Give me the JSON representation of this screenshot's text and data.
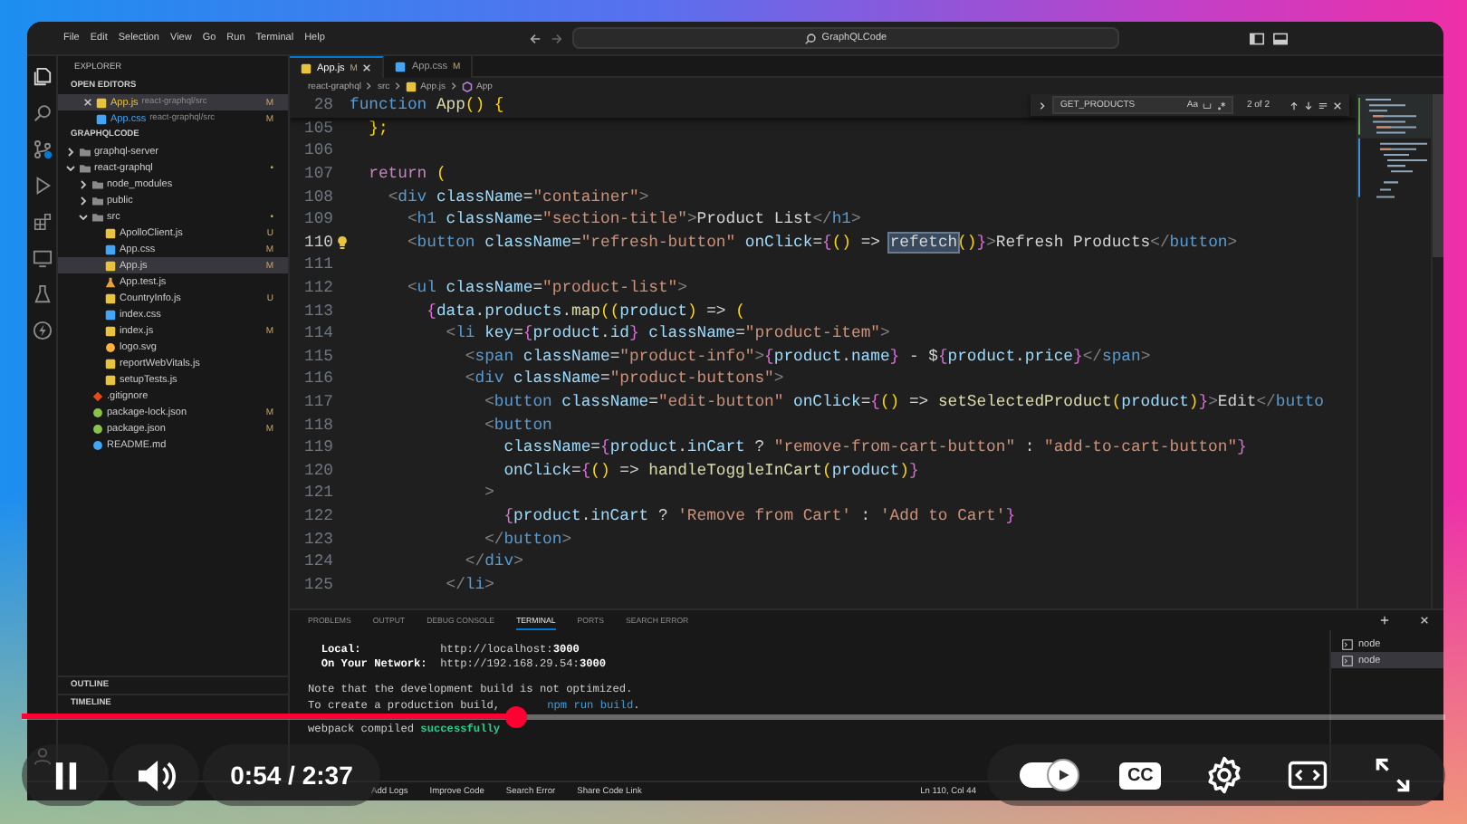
{
  "title_bar": {
    "menu": [
      "File",
      "Edit",
      "Selection",
      "View",
      "Go",
      "Run",
      "Terminal",
      "Help"
    ],
    "command_center": "GraphQLCode"
  },
  "sidebar": {
    "title": "EXPLORER",
    "open_editors": {
      "title": "OPEN EDITORS",
      "items": [
        {
          "kind": "js",
          "label": "App.js",
          "path": "react-graphql/src",
          "badge": "M",
          "selected": true
        },
        {
          "kind": "css",
          "label": "App.css",
          "path": "react-graphql/src",
          "badge": "M",
          "selected": false
        }
      ]
    },
    "workspace": {
      "title": "GRAPHQLCODE",
      "tree": [
        {
          "kind": "folder",
          "label": "graphql-server",
          "expanded": false,
          "selected": false
        },
        {
          "kind": "folder",
          "label": "react-graphql",
          "badge": "•",
          "expanded": true,
          "selected": false,
          "children": [
            {
              "kind": "folder",
              "label": "node_modules",
              "expanded": false,
              "selected": false
            },
            {
              "kind": "folder",
              "label": "public",
              "expanded": false,
              "selected": false
            },
            {
              "kind": "folder",
              "label": "src",
              "badge": "•",
              "expanded": true,
              "selected": false,
              "children": [
                {
                  "kind": "js",
                  "label": "ApolloClient.js",
                  "badge": "U",
                  "selected": false
                },
                {
                  "kind": "css",
                  "label": "App.css",
                  "badge": "M",
                  "selected": false
                },
                {
                  "kind": "js",
                  "label": "App.js",
                  "badge": "M",
                  "selected": true
                },
                {
                  "kind": "test",
                  "label": "App.test.js",
                  "selected": false
                },
                {
                  "kind": "js",
                  "label": "CountryInfo.js",
                  "badge": "U",
                  "selected": false
                },
                {
                  "kind": "css",
                  "label": "index.css",
                  "selected": false
                },
                {
                  "kind": "js",
                  "label": "index.js",
                  "badge": "M",
                  "selected": false
                },
                {
                  "kind": "svg",
                  "label": "logo.svg",
                  "selected": false
                },
                {
                  "kind": "js",
                  "label": "reportWebVitals.js",
                  "selected": false
                },
                {
                  "kind": "js",
                  "label": "setupTests.js",
                  "selected": false
                }
              ]
            },
            {
              "kind": "git",
              "label": ".gitignore",
              "selected": false
            },
            {
              "kind": "json",
              "label": "package-lock.json",
              "badge": "M",
              "selected": false
            },
            {
              "kind": "json",
              "label": "package.json",
              "badge": "M",
              "selected": false
            },
            {
              "kind": "md",
              "label": "README.md",
              "selected": false
            }
          ]
        }
      ]
    },
    "outline": "OUTLINE",
    "timeline": "TIMELINE"
  },
  "editor": {
    "tabs": [
      {
        "kind": "js",
        "label": "App.js",
        "badge": "M",
        "selected": true
      },
      {
        "kind": "css",
        "label": "App.css",
        "badge": "M",
        "selected": false
      }
    ],
    "breadcrumb": [
      {
        "kind": "folder",
        "label": "react-graphql"
      },
      {
        "kind": "folder",
        "label": "src"
      },
      {
        "kind": "js",
        "label": "App.js"
      },
      {
        "kind": "symbol",
        "label": "App"
      }
    ],
    "find": {
      "value": "GET_PRODUCTS",
      "match_case": "Aa",
      "count": "2 of 2"
    },
    "sticky_line": {
      "number": "28",
      "tokens": [
        {
          "kind": "keyword",
          "text": "function "
        },
        {
          "kind": "fn",
          "text": "App"
        },
        {
          "kind": "paren",
          "text": "() {"
        }
      ]
    },
    "lines": [
      {
        "number": "105",
        "current": false,
        "tokens": [
          {
            "kind": "paren",
            "text": "  };"
          }
        ]
      },
      {
        "number": "106",
        "current": false
      },
      {
        "number": "107",
        "current": false,
        "tokens": [
          {
            "kind": "control",
            "text": "  return "
          },
          {
            "kind": "paren",
            "text": "("
          }
        ]
      },
      {
        "number": "108",
        "current": false,
        "tokens": [
          {
            "kind": "punct",
            "text": "    <"
          },
          {
            "kind": "tag",
            "text": "div"
          },
          {
            "kind": "attr",
            "text": " className"
          },
          {
            "kind": "text",
            "text": "="
          },
          {
            "kind": "str",
            "text": "\"container\""
          },
          {
            "kind": "punct",
            "text": ">"
          }
        ]
      },
      {
        "number": "109",
        "current": false,
        "tokens": [
          {
            "kind": "punct",
            "text": "      <"
          },
          {
            "kind": "tag",
            "text": "h1"
          },
          {
            "kind": "attr",
            "text": " className"
          },
          {
            "kind": "text",
            "text": "="
          },
          {
            "kind": "str",
            "text": "\"section-title\""
          },
          {
            "kind": "punct",
            "text": ">"
          },
          {
            "kind": "text",
            "text": "Product List"
          },
          {
            "kind": "punct",
            "text": "</"
          },
          {
            "kind": "tag",
            "text": "h1"
          },
          {
            "kind": "punct",
            "text": ">"
          }
        ]
      },
      {
        "number": "110",
        "current": true,
        "tokens": [
          {
            "kind": "punct",
            "text": "      <"
          },
          {
            "kind": "tag",
            "text": "button"
          },
          {
            "kind": "attr",
            "text": " className"
          },
          {
            "kind": "text",
            "text": "="
          },
          {
            "kind": "str",
            "text": "\"refresh-button\""
          },
          {
            "kind": "attr",
            "text": " onClick"
          },
          {
            "kind": "text",
            "text": "="
          },
          {
            "kind": "brace",
            "text": "{"
          },
          {
            "kind": "paren",
            "text": "()"
          },
          {
            "kind": "text",
            "text": " => "
          },
          {
            "kind": "match",
            "text": "refetch"
          },
          {
            "kind": "paren",
            "text": "()"
          },
          {
            "kind": "brace",
            "text": "}"
          },
          {
            "kind": "punct",
            "text": ">"
          },
          {
            "kind": "text",
            "text": "Refresh Products"
          },
          {
            "kind": "punct",
            "text": "</"
          },
          {
            "kind": "tag",
            "text": "button"
          },
          {
            "kind": "punct",
            "text": ">"
          }
        ]
      },
      {
        "number": "111",
        "current": false
      },
      {
        "number": "112",
        "current": false,
        "tokens": [
          {
            "kind": "punct",
            "text": "      <"
          },
          {
            "kind": "tag",
            "text": "ul"
          },
          {
            "kind": "attr",
            "text": " className"
          },
          {
            "kind": "text",
            "text": "="
          },
          {
            "kind": "str",
            "text": "\"product-list\""
          },
          {
            "kind": "punct",
            "text": ">"
          }
        ]
      },
      {
        "number": "113",
        "current": false,
        "tokens": [
          {
            "kind": "brace",
            "text": "        {"
          },
          {
            "kind": "var",
            "text": "data"
          },
          {
            "kind": "text",
            "text": "."
          },
          {
            "kind": "var",
            "text": "products"
          },
          {
            "kind": "text",
            "text": "."
          },
          {
            "kind": "fn",
            "text": "map"
          },
          {
            "kind": "paren",
            "text": "(("
          },
          {
            "kind": "var",
            "text": "product"
          },
          {
            "kind": "paren",
            "text": ")"
          },
          {
            "kind": "text",
            "text": " => "
          },
          {
            "kind": "paren",
            "text": "("
          }
        ]
      },
      {
        "number": "114",
        "current": false,
        "tokens": [
          {
            "kind": "punct",
            "text": "          <"
          },
          {
            "kind": "tag",
            "text": "li"
          },
          {
            "kind": "attr",
            "text": " key"
          },
          {
            "kind": "text",
            "text": "="
          },
          {
            "kind": "brace",
            "text": "{"
          },
          {
            "kind": "var",
            "text": "product"
          },
          {
            "kind": "text",
            "text": "."
          },
          {
            "kind": "var",
            "text": "id"
          },
          {
            "kind": "brace",
            "text": "}"
          },
          {
            "kind": "attr",
            "text": " className"
          },
          {
            "kind": "text",
            "text": "="
          },
          {
            "kind": "str",
            "text": "\"product-item\""
          },
          {
            "kind": "punct",
            "text": ">"
          }
        ]
      },
      {
        "number": "115",
        "current": false,
        "tokens": [
          {
            "kind": "punct",
            "text": "            <"
          },
          {
            "kind": "tag",
            "text": "span"
          },
          {
            "kind": "attr",
            "text": " className"
          },
          {
            "kind": "text",
            "text": "="
          },
          {
            "kind": "str",
            "text": "\"product-info\""
          },
          {
            "kind": "punct",
            "text": ">"
          },
          {
            "kind": "brace",
            "text": "{"
          },
          {
            "kind": "var",
            "text": "product"
          },
          {
            "kind": "text",
            "text": "."
          },
          {
            "kind": "var",
            "text": "name"
          },
          {
            "kind": "brace",
            "text": "}"
          },
          {
            "kind": "text",
            "text": " - $"
          },
          {
            "kind": "brace",
            "text": "{"
          },
          {
            "kind": "var",
            "text": "product"
          },
          {
            "kind": "text",
            "text": "."
          },
          {
            "kind": "var",
            "text": "price"
          },
          {
            "kind": "brace",
            "text": "}"
          },
          {
            "kind": "punct",
            "text": "</"
          },
          {
            "kind": "tag",
            "text": "span"
          },
          {
            "kind": "punct",
            "text": ">"
          }
        ]
      },
      {
        "number": "116",
        "current": false,
        "tokens": [
          {
            "kind": "punct",
            "text": "            <"
          },
          {
            "kind": "tag",
            "text": "div"
          },
          {
            "kind": "attr",
            "text": " className"
          },
          {
            "kind": "text",
            "text": "="
          },
          {
            "kind": "str",
            "text": "\"product-buttons\""
          },
          {
            "kind": "punct",
            "text": ">"
          }
        ]
      },
      {
        "number": "117",
        "current": false,
        "tokens": [
          {
            "kind": "punct",
            "text": "              <"
          },
          {
            "kind": "tag",
            "text": "button"
          },
          {
            "kind": "attr",
            "text": " className"
          },
          {
            "kind": "text",
            "text": "="
          },
          {
            "kind": "str",
            "text": "\"edit-button\""
          },
          {
            "kind": "attr",
            "text": " onClick"
          },
          {
            "kind": "text",
            "text": "="
          },
          {
            "kind": "brace",
            "text": "{"
          },
          {
            "kind": "paren",
            "text": "()"
          },
          {
            "kind": "text",
            "text": " => "
          },
          {
            "kind": "fn",
            "text": "setSelectedProduct"
          },
          {
            "kind": "paren",
            "text": "("
          },
          {
            "kind": "var",
            "text": "product"
          },
          {
            "kind": "paren",
            "text": ")"
          },
          {
            "kind": "brace",
            "text": "}"
          },
          {
            "kind": "punct",
            "text": ">"
          },
          {
            "kind": "text",
            "text": "Edit"
          },
          {
            "kind": "punct",
            "text": "</"
          },
          {
            "kind": "tag",
            "text": "butto"
          }
        ]
      },
      {
        "number": "118",
        "current": false,
        "tokens": [
          {
            "kind": "punct",
            "text": "              <"
          },
          {
            "kind": "tag",
            "text": "button"
          }
        ]
      },
      {
        "number": "119",
        "current": false,
        "tokens": [
          {
            "kind": "attr",
            "text": "                className"
          },
          {
            "kind": "text",
            "text": "="
          },
          {
            "kind": "brace",
            "text": "{"
          },
          {
            "kind": "var",
            "text": "product"
          },
          {
            "kind": "text",
            "text": "."
          },
          {
            "kind": "var",
            "text": "inCart"
          },
          {
            "kind": "text",
            "text": " ? "
          },
          {
            "kind": "str",
            "text": "\"remove-from-cart-button\""
          },
          {
            "kind": "text",
            "text": " : "
          },
          {
            "kind": "str",
            "text": "\"add-to-cart-button\""
          },
          {
            "kind": "brace",
            "text": "}"
          }
        ]
      },
      {
        "number": "120",
        "current": false,
        "tokens": [
          {
            "kind": "attr",
            "text": "                onClick"
          },
          {
            "kind": "text",
            "text": "="
          },
          {
            "kind": "brace",
            "text": "{"
          },
          {
            "kind": "paren",
            "text": "()"
          },
          {
            "kind": "text",
            "text": " => "
          },
          {
            "kind": "fn",
            "text": "handleToggleInCart"
          },
          {
            "kind": "paren",
            "text": "("
          },
          {
            "kind": "var",
            "text": "product"
          },
          {
            "kind": "paren",
            "text": ")"
          },
          {
            "kind": "brace",
            "text": "}"
          }
        ]
      },
      {
        "number": "121",
        "current": false,
        "tokens": [
          {
            "kind": "punct",
            "text": "              >"
          }
        ]
      },
      {
        "number": "122",
        "current": false,
        "tokens": [
          {
            "kind": "brace",
            "text": "                {"
          },
          {
            "kind": "var",
            "text": "product"
          },
          {
            "kind": "text",
            "text": "."
          },
          {
            "kind": "var",
            "text": "inCart"
          },
          {
            "kind": "text",
            "text": " ? "
          },
          {
            "kind": "str",
            "text": "'Remove from Cart'"
          },
          {
            "kind": "text",
            "text": " : "
          },
          {
            "kind": "str",
            "text": "'Add to Cart'"
          },
          {
            "kind": "brace",
            "text": "}"
          }
        ]
      },
      {
        "number": "123",
        "current": false,
        "tokens": [
          {
            "kind": "punct",
            "text": "              </"
          },
          {
            "kind": "tag",
            "text": "button"
          },
          {
            "kind": "punct",
            "text": ">"
          }
        ]
      },
      {
        "number": "124",
        "current": false,
        "tokens": [
          {
            "kind": "punct",
            "text": "            </"
          },
          {
            "kind": "tag",
            "text": "div"
          },
          {
            "kind": "punct",
            "text": ">"
          }
        ]
      },
      {
        "number": "125",
        "current": false,
        "tokens": [
          {
            "kind": "punct",
            "text": "          </"
          },
          {
            "kind": "tag",
            "text": "li"
          },
          {
            "kind": "punct",
            "text": ">"
          }
        ]
      }
    ]
  },
  "panel": {
    "tabs": [
      {
        "label": "PROBLEMS",
        "selected": false
      },
      {
        "label": "OUTPUT",
        "selected": false
      },
      {
        "label": "DEBUG CONSOLE",
        "selected": false
      },
      {
        "label": "TERMINAL",
        "selected": true
      },
      {
        "label": "PORTS",
        "selected": false
      },
      {
        "label": "SEARCH ERROR",
        "selected": false
      }
    ],
    "terminal_blocks": [
      [
        [
          {
            "kind": "bold",
            "text": "  Local:            "
          },
          {
            "kind": "plain",
            "text": "http://localhost:"
          },
          {
            "kind": "bold",
            "text": "3000"
          }
        ],
        [
          {
            "kind": "bold",
            "text": "  On Your Network:  "
          },
          {
            "kind": "plain",
            "text": "http://192.168.29.54:"
          },
          {
            "kind": "bold",
            "text": "3000"
          }
        ]
      ],
      [
        [
          {
            "kind": "plain",
            "text": "Note that the development build is not optimized."
          }
        ],
        [
          {
            "kind": "plain",
            "text": "To create a production build,"
          },
          {
            "kind": "cmd",
            "text": "npm run build"
          },
          {
            "kind": "plain",
            "text": "."
          }
        ]
      ],
      [
        [
          {
            "kind": "plain",
            "text": "webpack compiled "
          },
          {
            "kind": "success",
            "text": "successfully"
          }
        ]
      ]
    ],
    "terminals": [
      {
        "label": "node",
        "selected": false
      },
      {
        "label": "node",
        "selected": true
      }
    ]
  },
  "status_bar": [
    "Add Logs",
    "Improve Code",
    "Search Error",
    "Share Code Link",
    "Ln 110, Col 44"
  ],
  "player": {
    "level": 0.347,
    "time": "0:54 / 2:37",
    "autoplay": true,
    "captions_label": "CC"
  }
}
